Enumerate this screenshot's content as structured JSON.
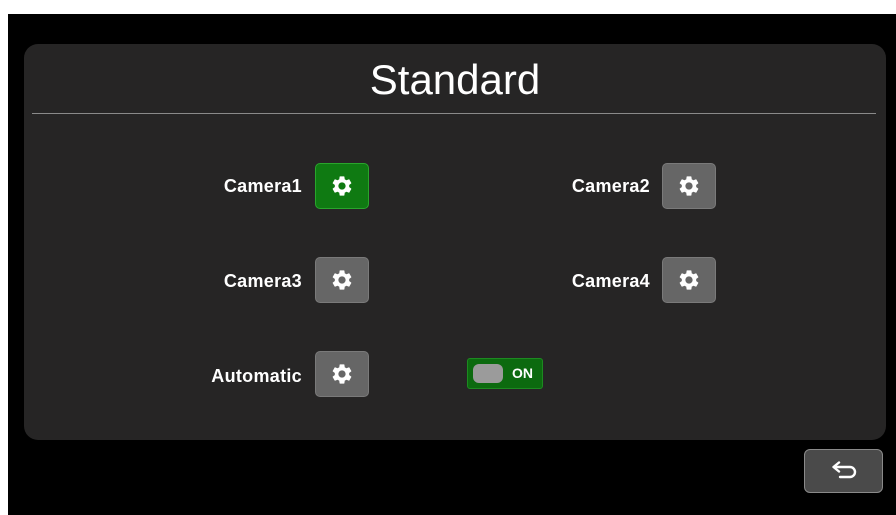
{
  "page": {
    "title": "Standard"
  },
  "cameras": [
    {
      "label": "Camera1",
      "settings_icon": "gear-icon",
      "selected": true
    },
    {
      "label": "Camera2",
      "settings_icon": "gear-icon",
      "selected": false
    },
    {
      "label": "Camera3",
      "settings_icon": "gear-icon",
      "selected": false
    },
    {
      "label": "Camera4",
      "settings_icon": "gear-icon",
      "selected": false
    }
  ],
  "automatic": {
    "label": "Automatic",
    "settings_icon": "gear-icon",
    "toggle_state": "ON"
  },
  "footer": {
    "back_icon": "return-arrow-icon"
  },
  "colors": {
    "background": "#000000",
    "panel": "#262525",
    "button": "#666666",
    "selected": "#0f7a12",
    "text": "#ffffff"
  }
}
